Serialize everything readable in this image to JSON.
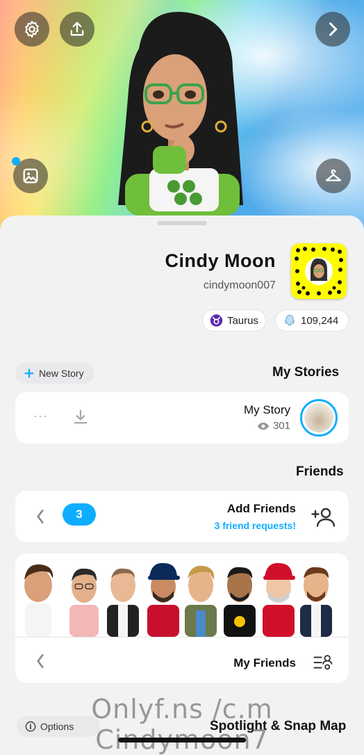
{
  "profile": {
    "display_name": "Cindy Moon",
    "username": "cindymoon007",
    "score": "109,244",
    "zodiac": "Taurus"
  },
  "stories": {
    "title": "My Stories",
    "new_story_label": "New Story",
    "my_story_label": "My Story",
    "views": "301",
    "more_label": "···"
  },
  "friends": {
    "title": "Friends",
    "add_friends_label": "Add Friends",
    "requests_label": "3 friend requests!",
    "requests_count": "3",
    "my_friends_label": "My Friends"
  },
  "spotlight": {
    "title": "Spotlight & Snap Map",
    "options_label": "Options"
  },
  "watermark": "Onlyf.ns /c.m Cindymoon7",
  "colors": {
    "accent_blue": "#0eadff",
    "snap_yellow": "#fffc00",
    "zodiac_purple": "#5b2bb0"
  },
  "icons": [
    "gear-icon",
    "upload-icon",
    "chevron-right-icon",
    "photo-icon",
    "hanger-icon",
    "ghost-icon",
    "taurus-icon",
    "plus-icon",
    "eye-icon",
    "download-icon",
    "more-icon",
    "add-friend-icon",
    "chevron-left-icon",
    "friends-list-icon",
    "info-icon"
  ]
}
